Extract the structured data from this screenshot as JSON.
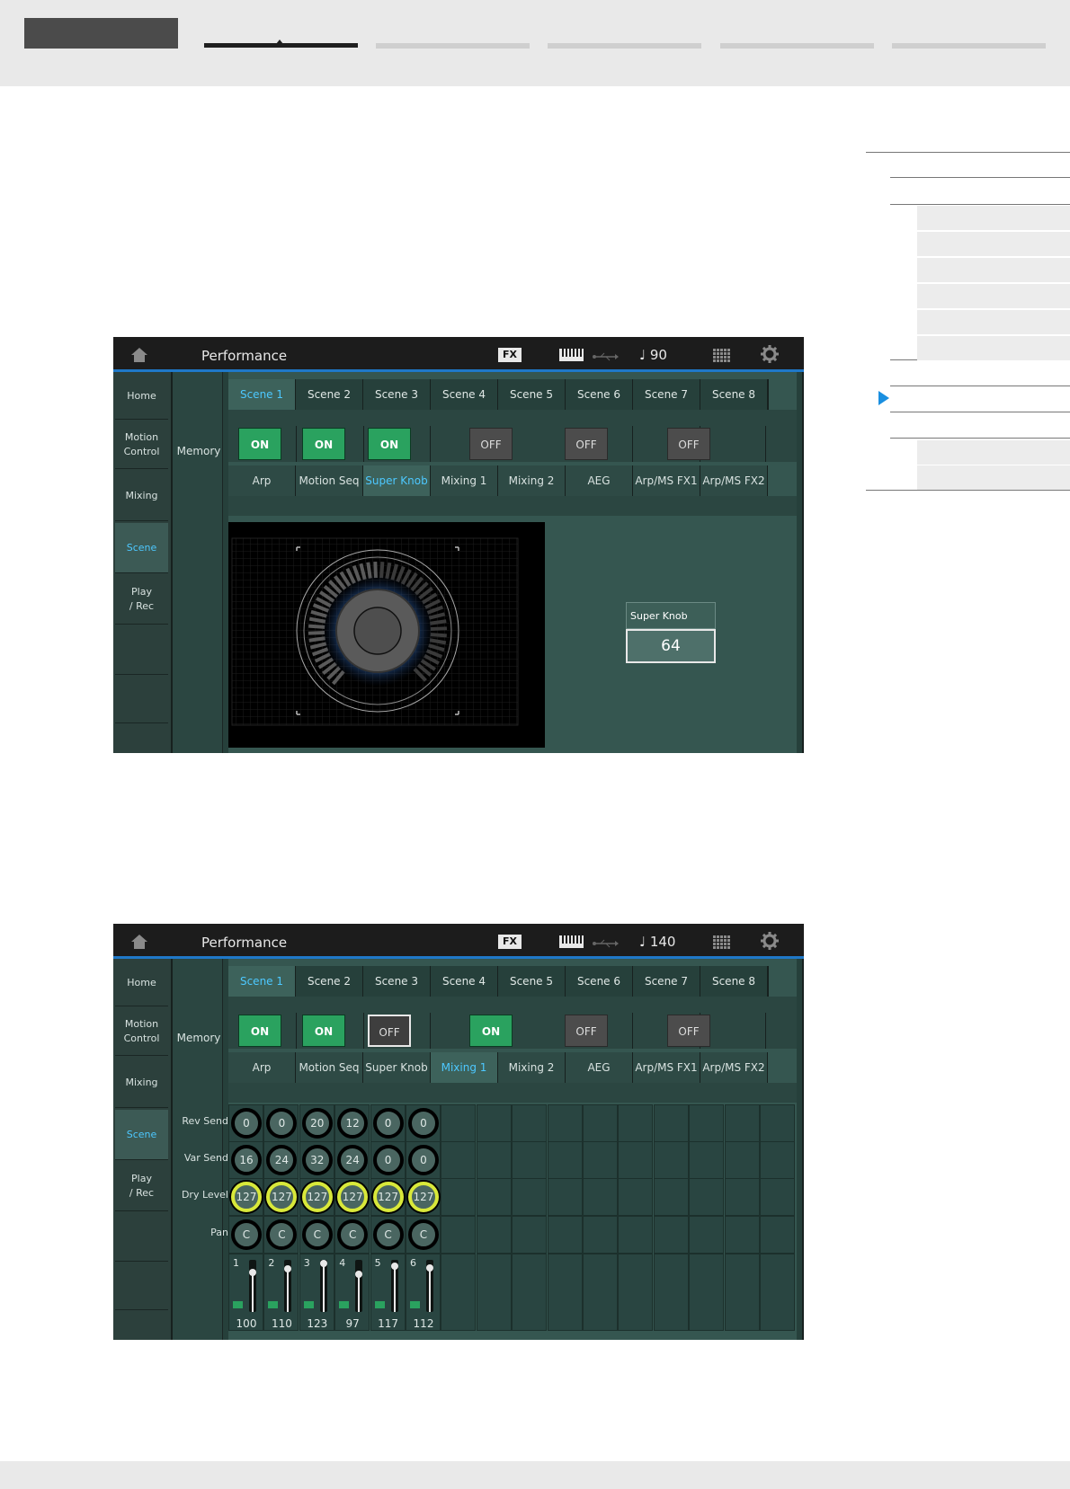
{
  "doc": {
    "toc_items": 15
  },
  "screens": [
    {
      "header": {
        "title": "Performance",
        "fx": "FX",
        "tempo": "♩ 90"
      },
      "sidebar": [
        "Home",
        "Motion\nControl",
        "Mixing",
        "Scene",
        "Play\n/ Rec"
      ],
      "sidebar_active": "Scene",
      "memory_label": "Memory",
      "scene_tabs": [
        "Scene 1",
        "Scene 2",
        "Scene 3",
        "Scene 4",
        "Scene 5",
        "Scene 6",
        "Scene 7",
        "Scene 8"
      ],
      "memory_buttons": [
        "ON",
        "ON",
        "ON",
        "OFF",
        "OFF",
        "OFF"
      ],
      "categories": [
        "Arp",
        "Motion Seq",
        "Super Knob",
        "Mixing 1",
        "Mixing 2",
        "AEG",
        "Arp/MS FX1",
        "Arp/MS FX2"
      ],
      "active_category": "Super Knob",
      "super_knob_label": "Super Knob",
      "super_knob_value": "64"
    },
    {
      "header": {
        "title": "Performance",
        "fx": "FX",
        "tempo": "♩ 140"
      },
      "sidebar": [
        "Home",
        "Motion\nControl",
        "Mixing",
        "Scene",
        "Play\n/ Rec"
      ],
      "sidebar_active": "Scene",
      "memory_label": "Memory",
      "scene_tabs": [
        "Scene 1",
        "Scene 2",
        "Scene 3",
        "Scene 4",
        "Scene 5",
        "Scene 6",
        "Scene 7",
        "Scene 8"
      ],
      "memory_buttons": [
        "ON",
        "ON",
        "OFF",
        "ON",
        "OFF",
        "OFF"
      ],
      "categories": [
        "Arp",
        "Motion Seq",
        "Super Knob",
        "Mixing 1",
        "Mixing 2",
        "AEG",
        "Arp/MS FX1",
        "Arp/MS FX2"
      ],
      "active_category": "Mixing 1",
      "mix_labels": [
        "Rev Send",
        "Var Send",
        "Dry Level",
        "Pan"
      ],
      "rev_send": [
        "0",
        "0",
        "20",
        "12",
        "0",
        "0"
      ],
      "var_send": [
        "16",
        "24",
        "32",
        "24",
        "0",
        "0"
      ],
      "dry_level": [
        "127",
        "127",
        "127",
        "127",
        "127",
        "127"
      ],
      "pan": [
        "C",
        "C",
        "C",
        "C",
        "C",
        "C"
      ],
      "part_numbers": [
        "1",
        "2",
        "3",
        "4",
        "5",
        "6"
      ],
      "volumes": [
        "100",
        "110",
        "123",
        "97",
        "117",
        "112"
      ]
    }
  ]
}
